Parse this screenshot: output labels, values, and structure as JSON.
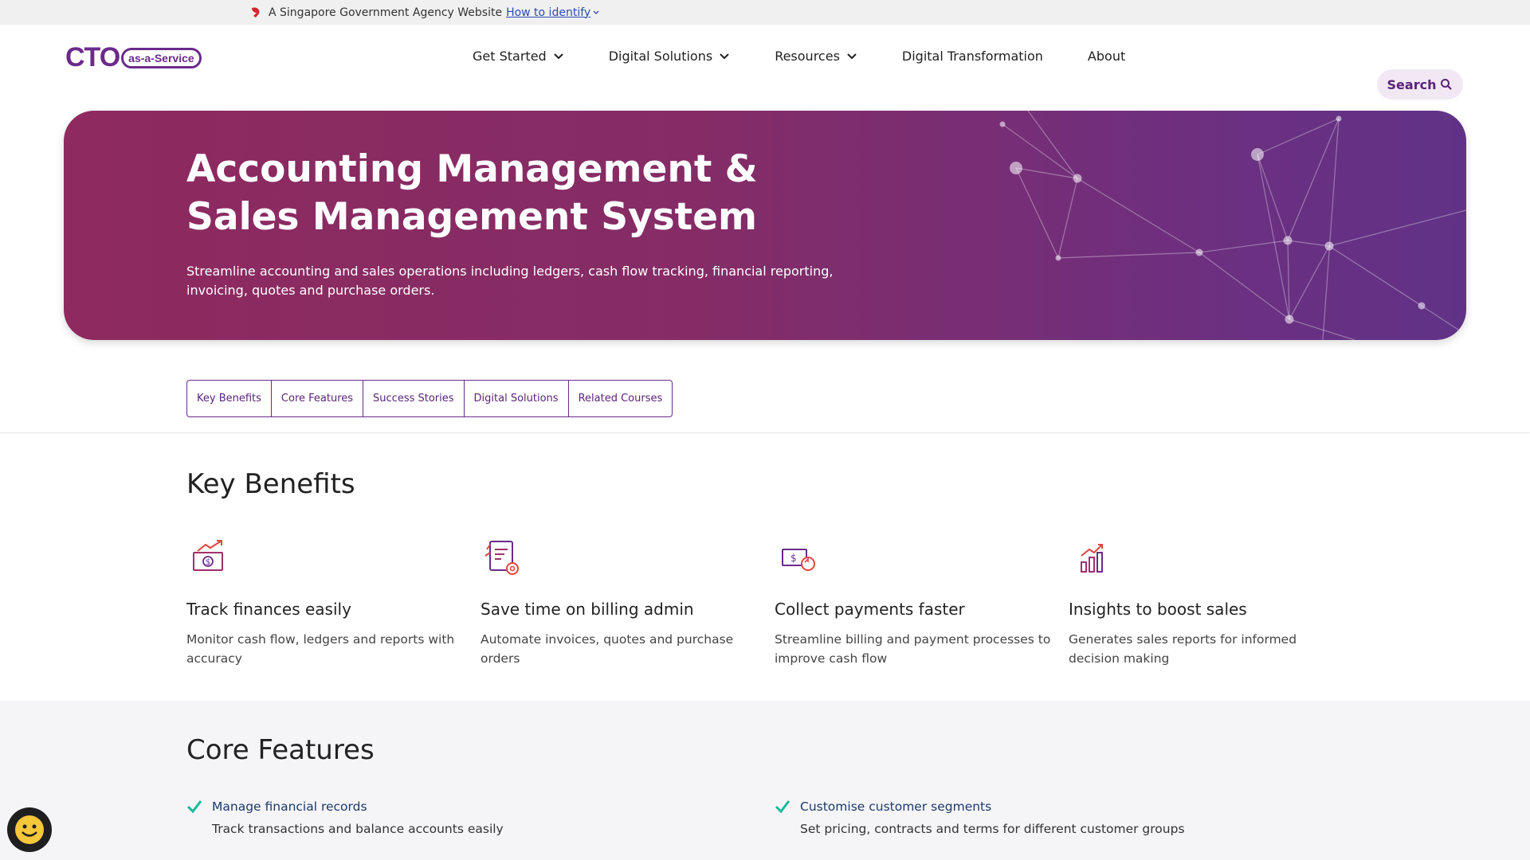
{
  "masthead": {
    "text": "A Singapore Government Agency Website",
    "link": "How to identify"
  },
  "logo": {
    "main": "CTO",
    "badge": "as-a-Service"
  },
  "nav": {
    "items": [
      {
        "label": "Get Started",
        "dropdown": true
      },
      {
        "label": "Digital Solutions",
        "dropdown": true
      },
      {
        "label": "Resources",
        "dropdown": true
      },
      {
        "label": "Digital Transformation",
        "dropdown": false
      },
      {
        "label": "About",
        "dropdown": false
      }
    ],
    "search_label": "Search"
  },
  "hero": {
    "title": "Accounting Management & Sales Management System",
    "description": "Streamline accounting and sales operations including ledgers, cash flow tracking, financial reporting, invoicing, quotes and purchase orders."
  },
  "tabs": [
    "Key Benefits",
    "Core Features",
    "Success Stories",
    "Digital Solutions",
    "Related Courses"
  ],
  "key_benefits": {
    "title": "Key Benefits",
    "items": [
      {
        "icon": "money-growth-icon",
        "title": "Track finances easily",
        "text": "Monitor cash flow, ledgers and reports with accuracy"
      },
      {
        "icon": "invoice-gear-icon",
        "title": "Save time on billing admin",
        "text": "Automate invoices, quotes and purchase orders"
      },
      {
        "icon": "payment-cycle-icon",
        "title": "Collect payments faster",
        "text": "Streamline billing and payment processes to improve cash flow"
      },
      {
        "icon": "bar-chart-growth-icon",
        "title": "Insights to boost sales",
        "text": "Generates sales reports for informed decision making"
      }
    ]
  },
  "core_features": {
    "title": "Core Features",
    "items": [
      {
        "title": "Manage financial records",
        "text": "Track transactions and balance accounts easily"
      },
      {
        "title": "Customise customer segments",
        "text": "Set pricing, contracts and terms for different customer groups"
      }
    ]
  },
  "colors": {
    "brand_purple": "#6b2a8a",
    "hero_start": "#8e2a5f",
    "hero_end": "#603287",
    "check_green": "#1bb99a"
  }
}
